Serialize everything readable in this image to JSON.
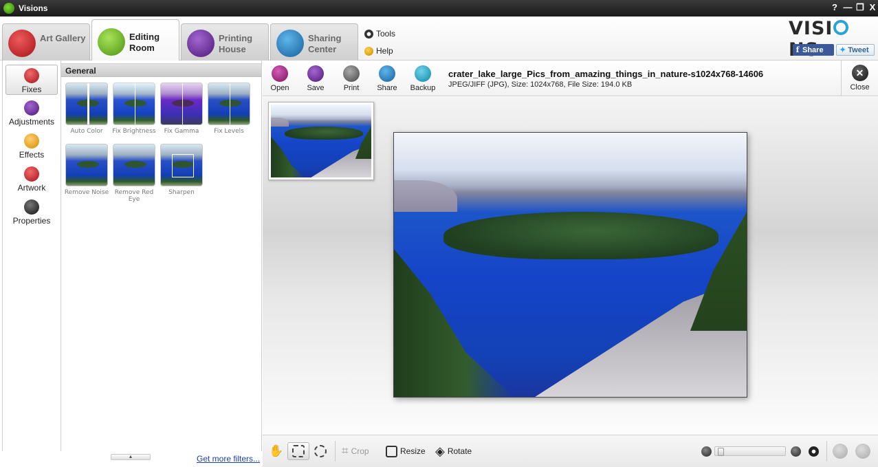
{
  "window": {
    "title": "Visions",
    "controls": {
      "help": "?",
      "minimize": "—",
      "restore": "❐",
      "close": "X"
    }
  },
  "tabs": [
    {
      "label": "Art Gallery",
      "icon": "film-strip-icon",
      "color": "#c8202a"
    },
    {
      "label": "Editing Room",
      "icon": "brush-icon",
      "color": "#6cb51f",
      "active": true
    },
    {
      "label": "Printing House",
      "icon": "printer-icon",
      "color": "#6a2a97"
    },
    {
      "label": "Sharing Center",
      "icon": "sync-icon",
      "color": "#1f7fc2"
    }
  ],
  "toplinks": {
    "tools": "Tools",
    "help": "Help"
  },
  "brand": {
    "pre": "VISI",
    "post": "NS"
  },
  "social": {
    "share": "Share",
    "tweet": "Tweet"
  },
  "leftnav": [
    {
      "label": "Fixes",
      "icon": "magic-wand-icon",
      "color": "#c8202a",
      "active": true
    },
    {
      "label": "Adjustments",
      "icon": "sliders-icon",
      "color": "#6a2a97"
    },
    {
      "label": "Effects",
      "icon": "lamp-icon",
      "color": "#e39b1a"
    },
    {
      "label": "Artwork",
      "icon": "palette-icon",
      "color": "#c8202a"
    },
    {
      "label": "Properties",
      "icon": "document-icon",
      "color": "#2a2a2a"
    }
  ],
  "filters": {
    "header": "General",
    "items": [
      {
        "label": "Auto Color"
      },
      {
        "label": "Fix Brightness"
      },
      {
        "label": "Fix Gamma"
      },
      {
        "label": "Fix Levels"
      },
      {
        "label": "Remove Noise"
      },
      {
        "label": "Remove Red Eye"
      },
      {
        "label": "Sharpen"
      }
    ],
    "more_link": "Get more filters...",
    "scroll_arrow": "▲"
  },
  "toolbar": {
    "buttons": [
      {
        "label": "Open",
        "icon": "open-icon",
        "color": "#8a1f6e"
      },
      {
        "label": "Save",
        "icon": "save-icon",
        "color": "#6a2a97"
      },
      {
        "label": "Print",
        "icon": "print-icon",
        "color": "#555555"
      },
      {
        "label": "Share",
        "icon": "share-icon",
        "color": "#1f7fc2"
      },
      {
        "label": "Backup",
        "icon": "backup-icon",
        "color": "#17a1c4"
      }
    ],
    "file_name": "crater_lake_large_Pics_from_amazing_things_in_nature-s1024x768-14606",
    "file_info": "JPEG/JIFF (JPG), Size: 1024x768, File Size: 194.0 KB",
    "close_label": "Close",
    "close_glyph": "✕"
  },
  "bottombar": {
    "crop": "Crop",
    "resize": "Resize",
    "rotate": "Rotate"
  }
}
